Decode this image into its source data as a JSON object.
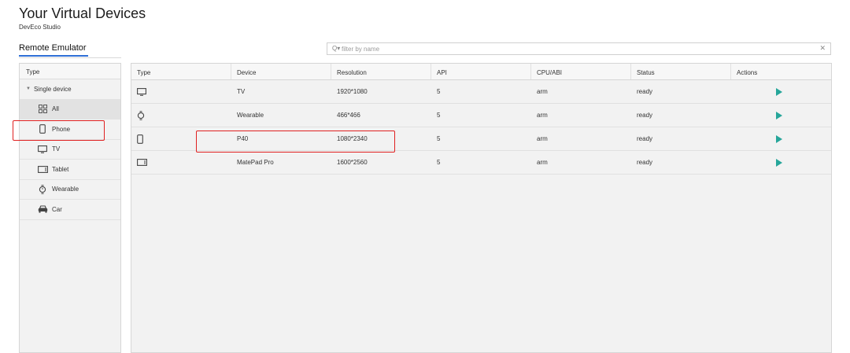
{
  "header": {
    "title": "Your Virtual Devices",
    "subtitle": "DevEco Studio"
  },
  "tabs": [
    {
      "label": "Remote Emulator"
    }
  ],
  "search": {
    "placeholder": "filter by name",
    "value": ""
  },
  "sidebar": {
    "header": "Type",
    "group_label": "Single device",
    "items": [
      {
        "label": "All",
        "icon": "all-icon",
        "selected": true
      },
      {
        "label": "Phone",
        "icon": "phone-icon"
      },
      {
        "label": "TV",
        "icon": "tv-icon"
      },
      {
        "label": "Tablet",
        "icon": "tablet-icon"
      },
      {
        "label": "Wearable",
        "icon": "watch-icon"
      },
      {
        "label": "Car",
        "icon": "car-icon"
      }
    ]
  },
  "table": {
    "columns": [
      "Type",
      "Device",
      "Resolution",
      "API",
      "CPU/ABI",
      "Status",
      "Actions"
    ],
    "rows": [
      {
        "type_icon": "tv-icon",
        "device": "TV",
        "resolution": "1920*1080",
        "api": "5",
        "cpu": "arm",
        "status": "ready",
        "action_icon": "play-icon"
      },
      {
        "type_icon": "watch-icon",
        "device": "Wearable",
        "resolution": "466*466",
        "api": "5",
        "cpu": "arm",
        "status": "ready",
        "action_icon": "play-icon"
      },
      {
        "type_icon": "phone-icon",
        "device": "P40",
        "resolution": "1080*2340",
        "api": "5",
        "cpu": "arm",
        "status": "ready",
        "action_icon": "play-icon"
      },
      {
        "type_icon": "tablet-icon",
        "device": "MatePad Pro",
        "resolution": "1600*2560",
        "api": "5",
        "cpu": "arm",
        "status": "ready",
        "action_icon": "play-icon"
      }
    ]
  },
  "colors": {
    "accent": "#2f6fd6",
    "play": "#26a69a",
    "highlight": "#e02020"
  }
}
